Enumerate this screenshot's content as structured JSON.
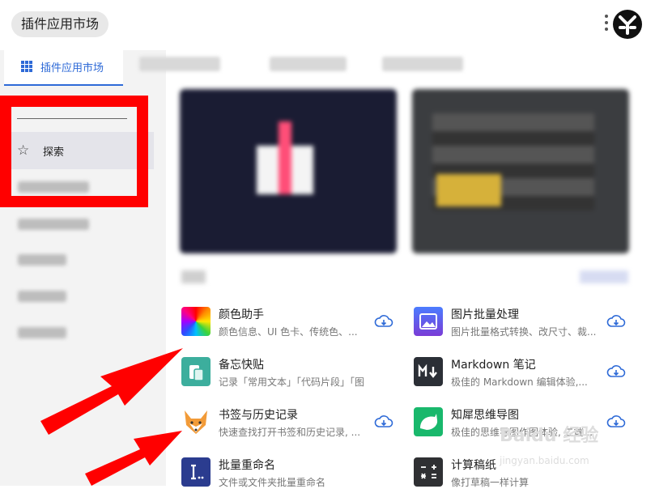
{
  "app": {
    "title": "插件应用市场"
  },
  "tabs": [
    {
      "label": "插件应用市场"
    }
  ],
  "sidebar": {
    "items": [
      {
        "label": "探索"
      }
    ]
  },
  "plugins": [
    {
      "name": "颜色助手",
      "desc": "颜色信息、UI 色卡、传统色、...",
      "icon": "color-wheel-icon"
    },
    {
      "name": "图片批量处理",
      "desc": "图片批量格式转换、改尺寸、裁...",
      "icon": "image-icon"
    },
    {
      "name": "备忘快贴",
      "desc": "记录「常用文本」「代码片段」「图...",
      "icon": "clipboard-icon"
    },
    {
      "name": "Markdown 笔记",
      "desc": "极佳的 Markdown 编辑体验,...",
      "icon": "markdown-icon"
    },
    {
      "name": "书签与历史记录",
      "desc": "快速查找打开书签和历史记录, ...",
      "icon": "fox-icon"
    },
    {
      "name": "知犀思维导图",
      "desc": "极佳的思维导图作图体验, 二端...",
      "icon": "rhino-icon"
    },
    {
      "name": "批量重命名",
      "desc": "文件或文件夹批量重命名",
      "icon": "rename-icon"
    },
    {
      "name": "计算稿纸",
      "desc": "像打草稿一样计算",
      "icon": "calculator-icon"
    }
  ],
  "watermark": {
    "brand": "Baidu 经验",
    "url": "jingyan.baidu.com"
  },
  "colors": {
    "accent": "#2e6ad7",
    "annotation": "#ff0000"
  }
}
